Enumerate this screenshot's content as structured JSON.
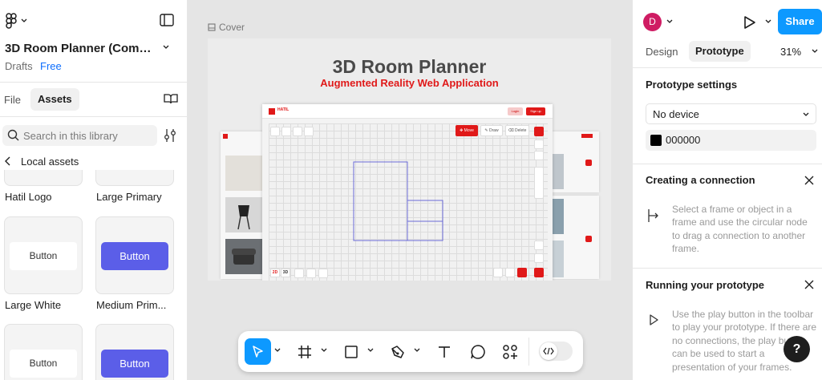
{
  "left_panel": {
    "file_title": "3D Room Planner (Commun...",
    "location": "Drafts",
    "plan": "Free",
    "tabs": {
      "file": "File",
      "assets": "Assets"
    },
    "search_placeholder": "Search in this library",
    "back_label": "Local assets",
    "assets": [
      {
        "name": "Hatil Logo"
      },
      {
        "name": "Large Primary"
      },
      {
        "name": "Large White",
        "preview_label": "Button"
      },
      {
        "name": "Medium Prim...",
        "preview_label": "Button"
      },
      {
        "preview_label": "Button"
      },
      {
        "preview_label": "Button"
      }
    ]
  },
  "canvas": {
    "frame_label": "Cover",
    "cover": {
      "title": "3D Room Planner",
      "subtitle": "Augmented Reality Web Application"
    },
    "toolbar": {
      "tools": [
        "move-tool",
        "frame-tool",
        "shape-tool",
        "pen-tool",
        "text-tool",
        "comment-tool",
        "actions-tool"
      ],
      "active_tool": "move-tool"
    }
  },
  "right_panel": {
    "avatar_initial": "D",
    "share_label": "Share",
    "tabs": {
      "design": "Design",
      "prototype": "Prototype"
    },
    "zoom": "31%",
    "prototype_settings": {
      "title": "Prototype settings",
      "device": "No device",
      "background_hex": "000000"
    },
    "creating_connection": {
      "title": "Creating a connection",
      "help": "Select a frame or object in a frame and use the circular node to drag a connection to another frame."
    },
    "running_prototype": {
      "title": "Running your prototype",
      "help": "Use the play button in the toolbar to play your prototype. If there are no connections, the play button can be used to start a presentation of your frames."
    },
    "help_button": "?"
  },
  "colors": {
    "accent": "#0d99ff",
    "avatar": "#cf1c63",
    "cover_red": "#e01919",
    "button_purple": "#5b5ee8"
  }
}
